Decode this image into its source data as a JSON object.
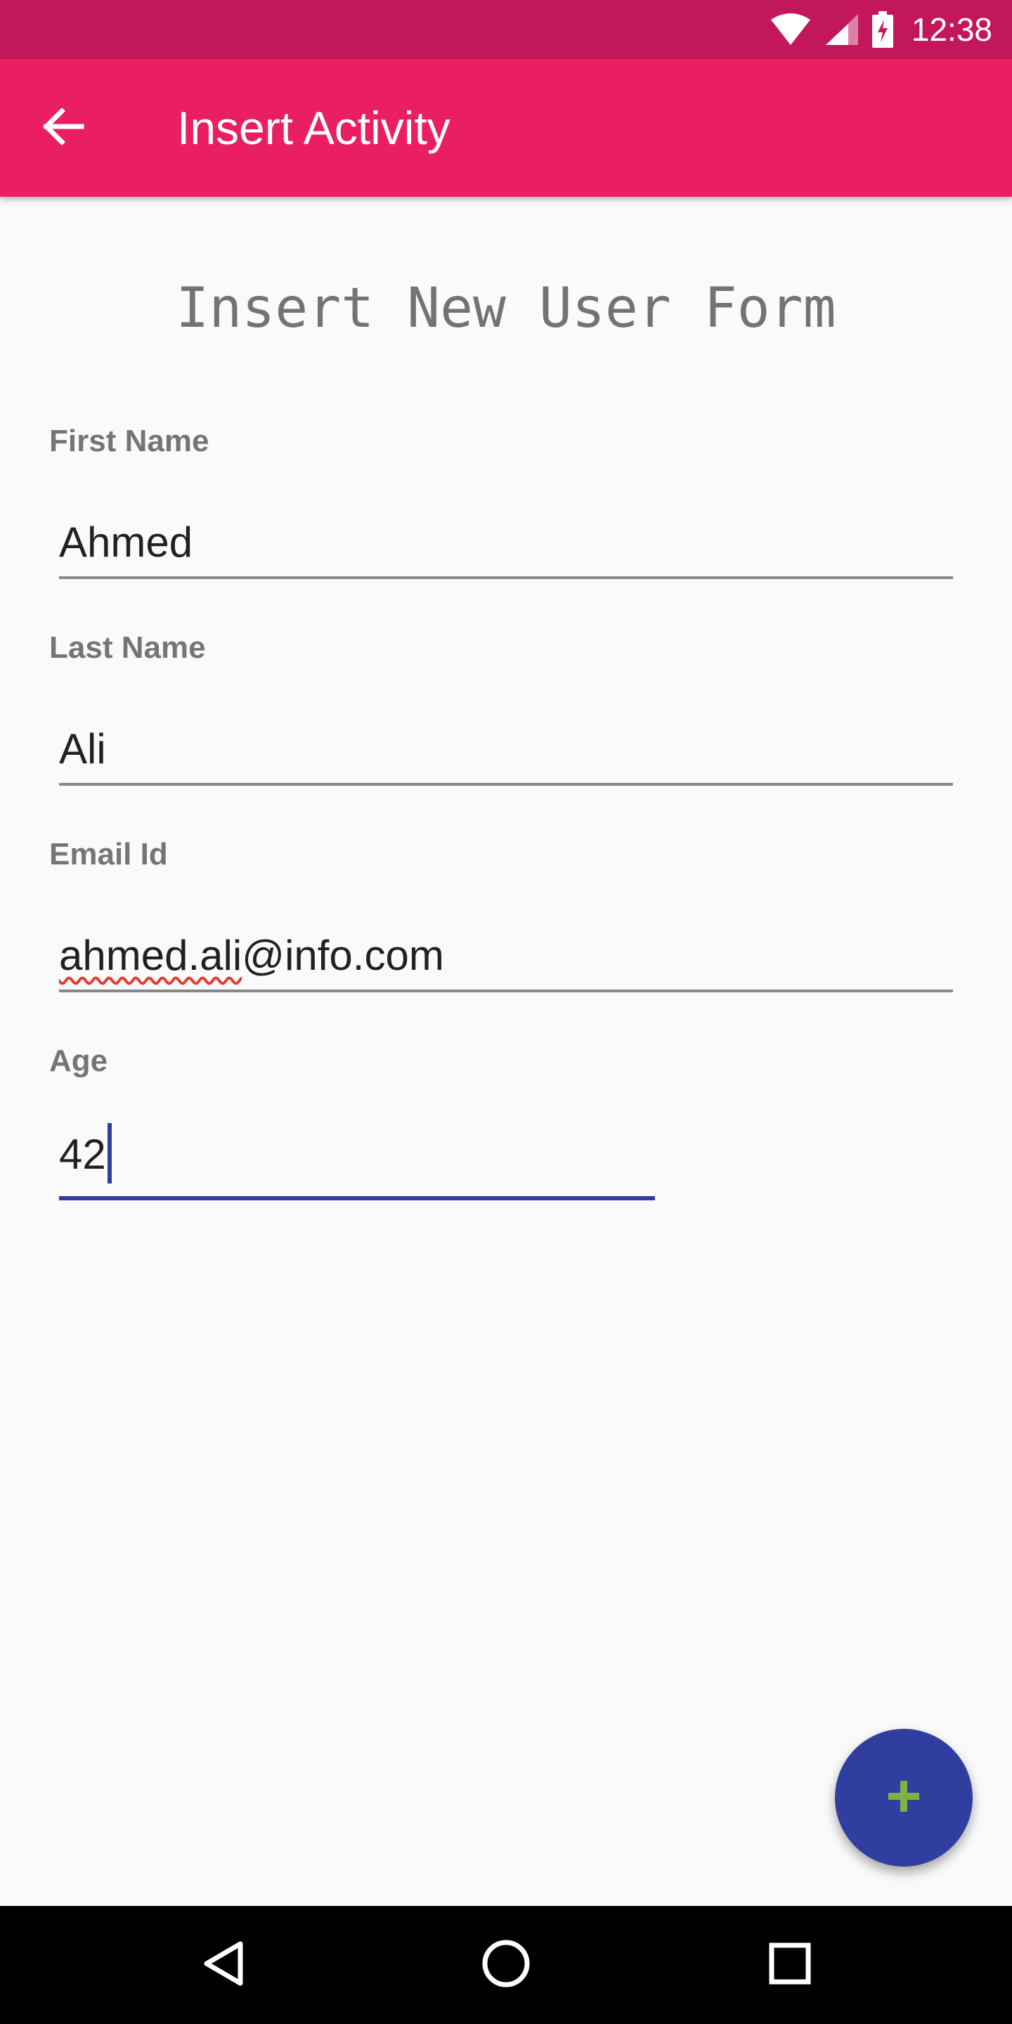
{
  "status_bar": {
    "time": "12:38",
    "icons": [
      "wifi-icon",
      "cellular-signal-icon",
      "battery-charging-icon"
    ]
  },
  "app_bar": {
    "title": "Insert Activity",
    "back_icon": "arrow-back-icon",
    "background_color": "#E91E63"
  },
  "form": {
    "heading": "Insert New User Form",
    "fields": [
      {
        "label": "First Name",
        "value": "Ahmed"
      },
      {
        "label": "Last Name",
        "value": "Ali"
      },
      {
        "label": "Email Id",
        "value_misspelled_part": "ahmed.ali",
        "value_rest": "@info.com"
      },
      {
        "label": "Age",
        "value": "42",
        "focused": true
      }
    ]
  },
  "fab": {
    "icon": "plus-icon",
    "background_color": "#303F9F",
    "icon_color": "#7CB342"
  },
  "nav_bar": {
    "buttons": [
      "back-triangle-icon",
      "home-circle-icon",
      "recents-square-icon"
    ]
  },
  "colors": {
    "status_bar": "#C2185B",
    "accent": "#303F9F",
    "spell_error": "#E53935"
  }
}
